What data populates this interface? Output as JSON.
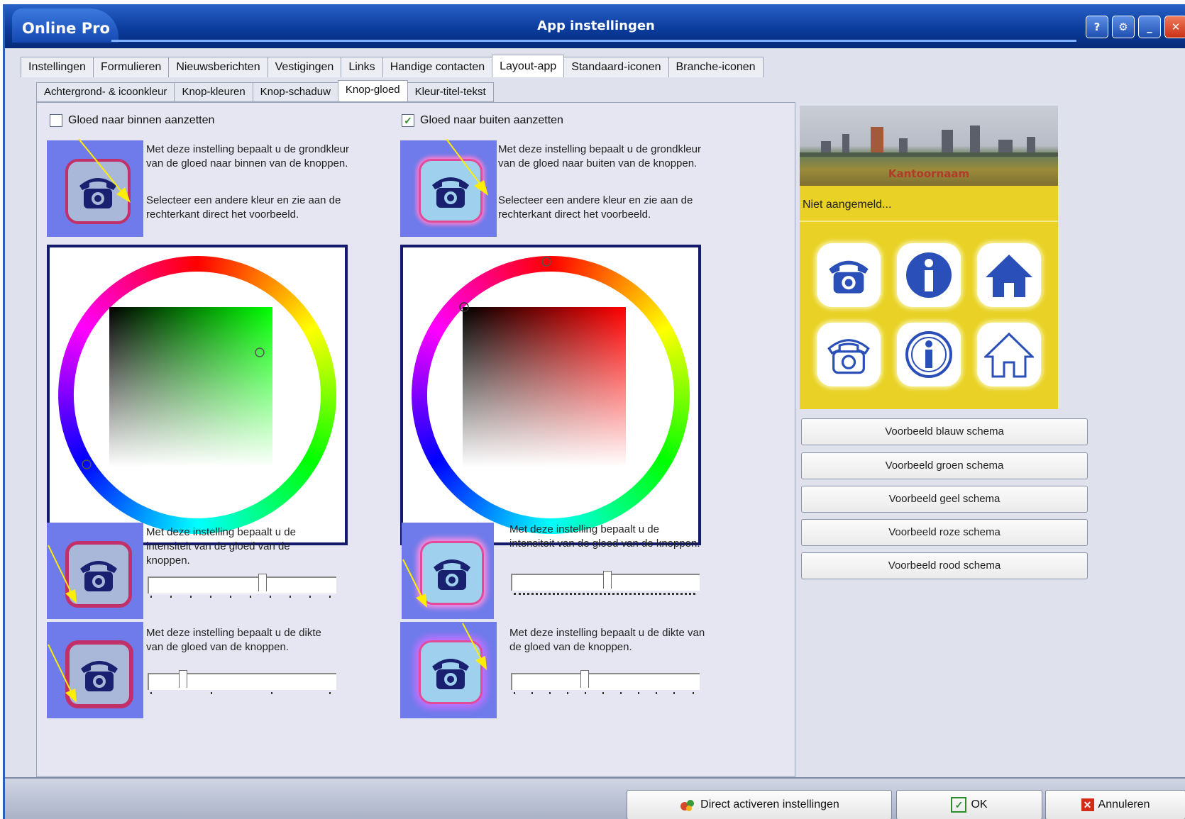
{
  "window": {
    "brand": "Online Pro",
    "title": "App instellingen",
    "buttons": {
      "help": "?",
      "settings": "⚙",
      "minimize": "_",
      "close": "✕"
    }
  },
  "main_tabs": [
    {
      "label": "Instellingen"
    },
    {
      "label": "Formulieren"
    },
    {
      "label": "Nieuwsberichten"
    },
    {
      "label": "Vestigingen"
    },
    {
      "label": "Links"
    },
    {
      "label": "Handige contacten"
    },
    {
      "label": "Layout-app",
      "active": true
    },
    {
      "label": "Standaard-iconen"
    },
    {
      "label": "Branche-iconen"
    }
  ],
  "sub_tabs": [
    {
      "label": "Achtergrond- & icoonkleur"
    },
    {
      "label": "Knop-kleuren"
    },
    {
      "label": "Knop-schaduw"
    },
    {
      "label": "Knop-gloed",
      "active": true
    },
    {
      "label": "Kleur-titel-tekst"
    }
  ],
  "inner_glow": {
    "checkbox_label": "Gloed naar binnen aanzetten",
    "checked": false,
    "color_desc_1": "Met deze instelling bepaalt u de grondkleur van de gloed naar binnen van de knoppen.",
    "color_desc_2": "Selecteer een andere kleur en zie aan de rechterkant direct het voorbeeld.",
    "intensity_desc": "Met deze instelling bepaalt u de intensiteit van de gloed van de knoppen.",
    "thickness_desc": "Met deze instelling bepaalt u de dikte van de gloed van de knoppen.",
    "hue_color": "#00ff00",
    "intensity_value": 0.6,
    "thickness_value": 0.2
  },
  "outer_glow": {
    "checkbox_label": "Gloed naar buiten aanzetten",
    "checked": true,
    "check_mark": "✓",
    "color_desc_1": "Met deze instelling bepaalt u de grondkleur van de gloed naar buiten van de knoppen.",
    "color_desc_2": "Selecteer een andere kleur en zie aan de rechterkant direct het voorbeeld.",
    "intensity_desc": "Met deze instelling bepaalt u de intensiteit van de gloed van de knoppen.",
    "thickness_desc": "Met deze instelling bepaalt u de dikte van de gloed van de knoppen.",
    "hue_color": "#ff0000",
    "intensity_value": 0.5,
    "thickness_value": 0.4
  },
  "preview": {
    "office_name": "Kantoornaam",
    "status": "Niet aangemeld...",
    "icons": [
      "phone-icon",
      "info-icon",
      "home-icon",
      "phone-outline-icon",
      "info-outline-icon",
      "home-outline-icon"
    ],
    "background_color": "#e9d225",
    "icon_color": "#2b4fb8"
  },
  "schema_buttons": [
    {
      "label": "Voorbeeld blauw schema"
    },
    {
      "label": "Voorbeeld groen schema"
    },
    {
      "label": "Voorbeeld geel schema"
    },
    {
      "label": "Voorbeeld roze schema"
    },
    {
      "label": "Voorbeeld rood schema"
    }
  ],
  "footer": {
    "activate_label": "Direct activeren instellingen",
    "ok_label": "OK",
    "ok_mark": "✓",
    "cancel_label": "Annuleren",
    "cancel_mark": "✕"
  }
}
